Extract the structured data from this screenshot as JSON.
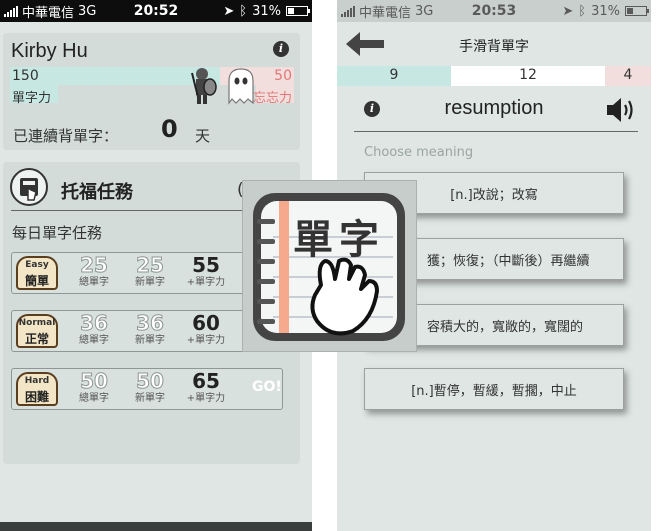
{
  "left": {
    "status": {
      "carrier": "中華電信",
      "network": "3G",
      "time": "20:52",
      "battery": "31%"
    },
    "profile": {
      "name": "Kirby Hu",
      "power_value": "150",
      "power_label": "單字力",
      "forget_value": "50",
      "forget_label": "忘忘力",
      "streak_label": "已連續背單字：",
      "streak_value": "0",
      "streak_unit": "天"
    },
    "missions": {
      "title": "托福任務",
      "daily_title": "每日單字任務",
      "stat_labels": {
        "total": "總單字",
        "new": "新單字",
        "power": "+單字力"
      },
      "tasks": [
        {
          "level_en": "Easy",
          "level_zh": "簡單",
          "total": "25",
          "new": "25",
          "power": "55"
        },
        {
          "level_en": "Normal",
          "level_zh": "正常",
          "total": "36",
          "new": "36",
          "power": "60"
        },
        {
          "level_en": "Hard",
          "level_zh": "困難",
          "total": "50",
          "new": "50",
          "power": "65",
          "go": "GO!"
        }
      ]
    }
  },
  "app_icon": {
    "text": "單字",
    "colors": {
      "spine": "#f7a98e",
      "rings": "#555555"
    }
  },
  "right": {
    "status": {
      "carrier": "中華電信",
      "network": "3G",
      "time": "20:53",
      "battery": "31%"
    },
    "nav_title": "手滑背單字",
    "progress": {
      "done": "9",
      "remaining": "12",
      "wrong": "4"
    },
    "word": "resumption",
    "prompt": "Choose meaning",
    "choices": [
      "[n.]改說；改寫",
      "獲；恢復；（中斷後）再繼續",
      "容積大的，寬敞的，寬闊的",
      "[n.]暫停，暫緩，暫擱，中止"
    ]
  },
  "colors": {
    "progress_good": "#c6e7e2",
    "progress_bad": "#f3dede",
    "panel": "#d3dcd8"
  }
}
